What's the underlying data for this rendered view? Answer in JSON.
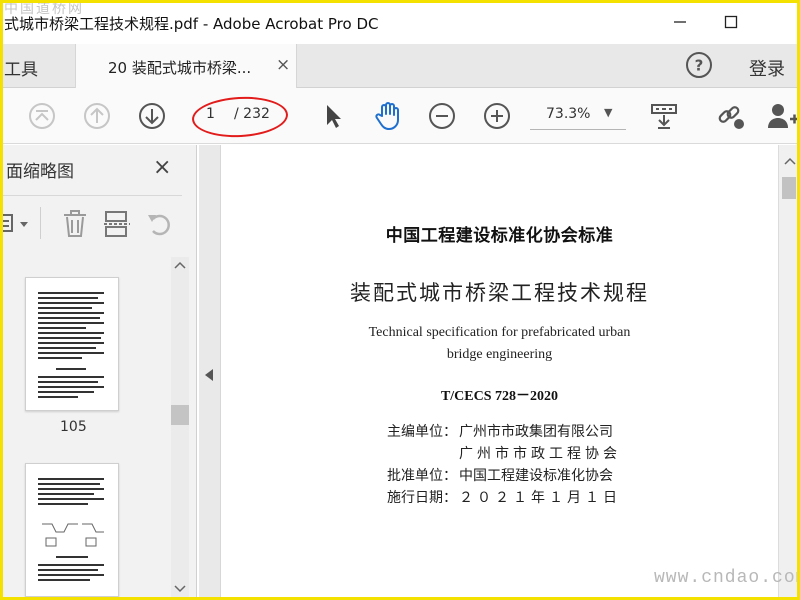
{
  "window": {
    "title": "式城市桥梁工程技术规程.pdf - Adobe Acrobat Pro DC"
  },
  "watermarks": {
    "top_left": "中国道桥网",
    "bottom_right": "www.cndao.com"
  },
  "tabs": {
    "tools_label": "工具",
    "document_label": "20 装配式城市桥梁...",
    "close_glyph": "×",
    "help_glyph": "?",
    "login_label": "登录"
  },
  "toolbar": {
    "current_page": "1",
    "total_pages": "/ 232",
    "zoom": "73.3%",
    "zoom_caret": "▼"
  },
  "left_panel": {
    "title": "面缩略图",
    "close_glyph": "×",
    "thumbnails": [
      {
        "label": "105"
      },
      {
        "label": ""
      }
    ]
  },
  "document": {
    "organization": "中国工程建设标准化协会标准",
    "title_cn": "装配式城市桥梁工程技术规程",
    "title_en_line1": "Technical specification for prefabricated urban",
    "title_en_line2": "bridge engineering",
    "standard_code": "T/CECS 728－2020",
    "editor_label": "主编单位：",
    "editor_1": "广州市市政集团有限公司",
    "editor_2": "广州市市政工程协会",
    "approver_label": "批准单位：",
    "approver": "中国工程建设标准化协会",
    "effective_label": "施行日期：",
    "effective_date": "２０２１年１月１日"
  },
  "colors": {
    "highlight_ellipse": "#e21b1b",
    "frame": "#f5e100",
    "hand_tool": "#1f6fcf",
    "icon_gray": "#6e6e6e"
  },
  "icons": [
    "first-page-icon",
    "prev-page-icon",
    "next-page-icon",
    "select-arrow-icon",
    "hand-icon",
    "zoom-out-icon",
    "zoom-in-icon",
    "fit-page-icon",
    "link-icon",
    "add-user-icon",
    "help-icon",
    "minimize-icon",
    "maximize-icon",
    "options-icon",
    "trash-icon",
    "extract-icon",
    "rotate-icon"
  ]
}
